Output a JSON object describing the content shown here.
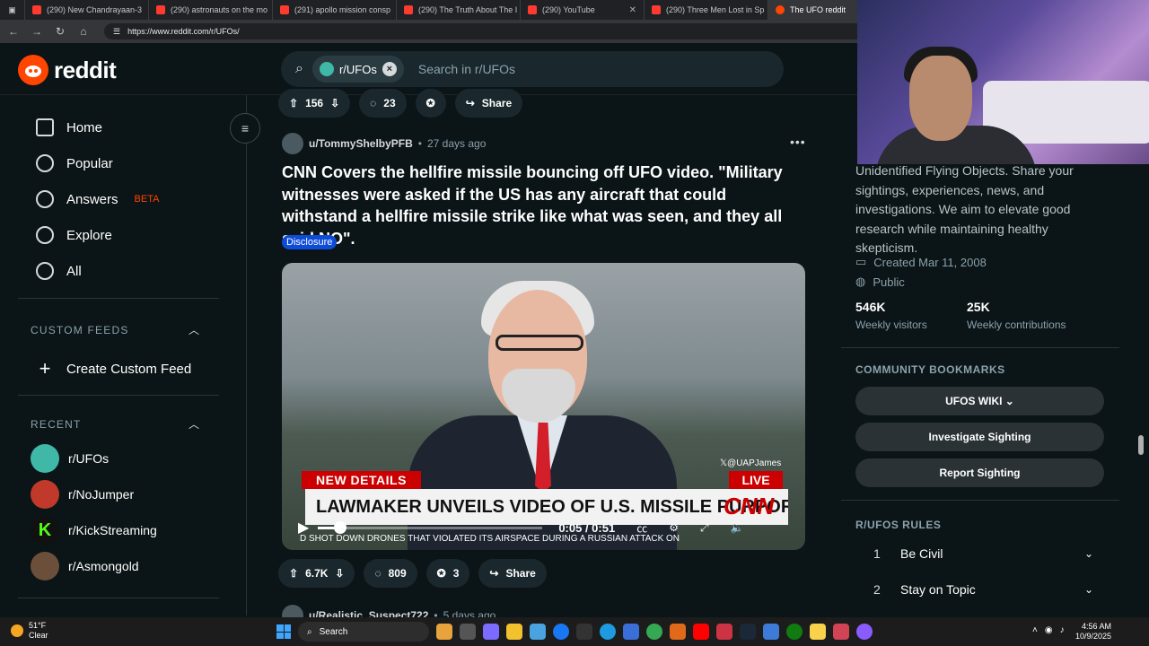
{
  "browser": {
    "tabs": [
      {
        "title": "(290) New Chandrayaan-3 ",
        "kind": "yt"
      },
      {
        "title": "(290) astronauts on the mo",
        "kind": "yt"
      },
      {
        "title": "(291) apollo mission consp",
        "kind": "yt"
      },
      {
        "title": "(290) The Truth About The I",
        "kind": "yt"
      },
      {
        "title": "(290) YouTube",
        "kind": "yt"
      },
      {
        "title": "(290) Three Men Lost in Sp",
        "kind": "yt"
      },
      {
        "title": "The UFO reddit",
        "kind": "reddit"
      }
    ],
    "url": "https://www.reddit.com/r/UFOs/"
  },
  "header": {
    "logo_text": "reddit",
    "search_chip": "r/UFOs",
    "search_placeholder": "Search in r/UFOs"
  },
  "sidebar": {
    "nav": [
      {
        "label": "Home",
        "icon": "home-icon"
      },
      {
        "label": "Popular",
        "icon": "popular-icon"
      },
      {
        "label": "Answers",
        "icon": "answers-icon",
        "badge": "BETA"
      },
      {
        "label": "Explore",
        "icon": "explore-icon"
      },
      {
        "label": "All",
        "icon": "all-icon"
      }
    ],
    "custom_feeds_header": "CUSTOM FEEDS",
    "create_feed": "Create Custom Feed",
    "recent_header": "RECENT",
    "recent": [
      {
        "label": "r/UFOs",
        "color": "#3fb8a8"
      },
      {
        "label": "r/NoJumper",
        "color": "#c0392b"
      },
      {
        "label": "r/KickStreaming",
        "color": "#53fc18"
      },
      {
        "label": "r/Asmongold",
        "color": "#6b4f3a"
      }
    ]
  },
  "prev_post_actions": {
    "upvotes": "156",
    "comments": "23",
    "share": "Share"
  },
  "post": {
    "user": "u/TommyShelbyPFB",
    "age": "27 days ago",
    "title": "CNN Covers the hellfire missile bouncing off UFO video. \"Military witnesses were asked if the US has any aircraft that could withstand a hellfire missile strike like what was seen, and they all said NO\".",
    "flair": "Disclosure",
    "video": {
      "new_details": "NEW DETAILS",
      "live": "LIVE",
      "handle": "𝕏@UAPJames",
      "headline": "LAWMAKER UNVEILS VIDEO OF U.S. MISSILE PURPORTEDLY",
      "network": "CNN",
      "ticker": "D SHOT DOWN DRONES THAT VIOLATED ITS AIRSPACE DURING A RUSSIAN ATTACK ON",
      "time": "0:05 / 0:51",
      "progress": 0.1
    },
    "upvotes": "6.7K",
    "comments": "809",
    "awards": "3",
    "share": "Share"
  },
  "next_post": {
    "user": "u/Realistic_Suspect722",
    "age": "5 days ago"
  },
  "rail": {
    "description": "Unidentified Flying Objects. Share your sightings, experiences, news, and investigations. We aim to elevate good research while maintaining healthy skepticism.",
    "created": "Created Mar 11, 2008",
    "visibility": "Public",
    "stats": [
      {
        "value": "546K",
        "label": "Weekly visitors"
      },
      {
        "value": "25K",
        "label": "Weekly contributions"
      }
    ],
    "bookmarks_header": "COMMUNITY BOOKMARKS",
    "bookmarks": [
      "UFOS WIKI",
      "Investigate Sighting",
      "Report Sighting"
    ],
    "rules_header": "R/UFOS RULES",
    "rules": [
      {
        "num": "1",
        "label": "Be Civil"
      },
      {
        "num": "2",
        "label": "Stay on Topic"
      }
    ]
  },
  "taskbar": {
    "temp": "51°F",
    "weather": "Clear",
    "search": "Search",
    "time": "4:56 AM",
    "date": "10/9/2025"
  }
}
